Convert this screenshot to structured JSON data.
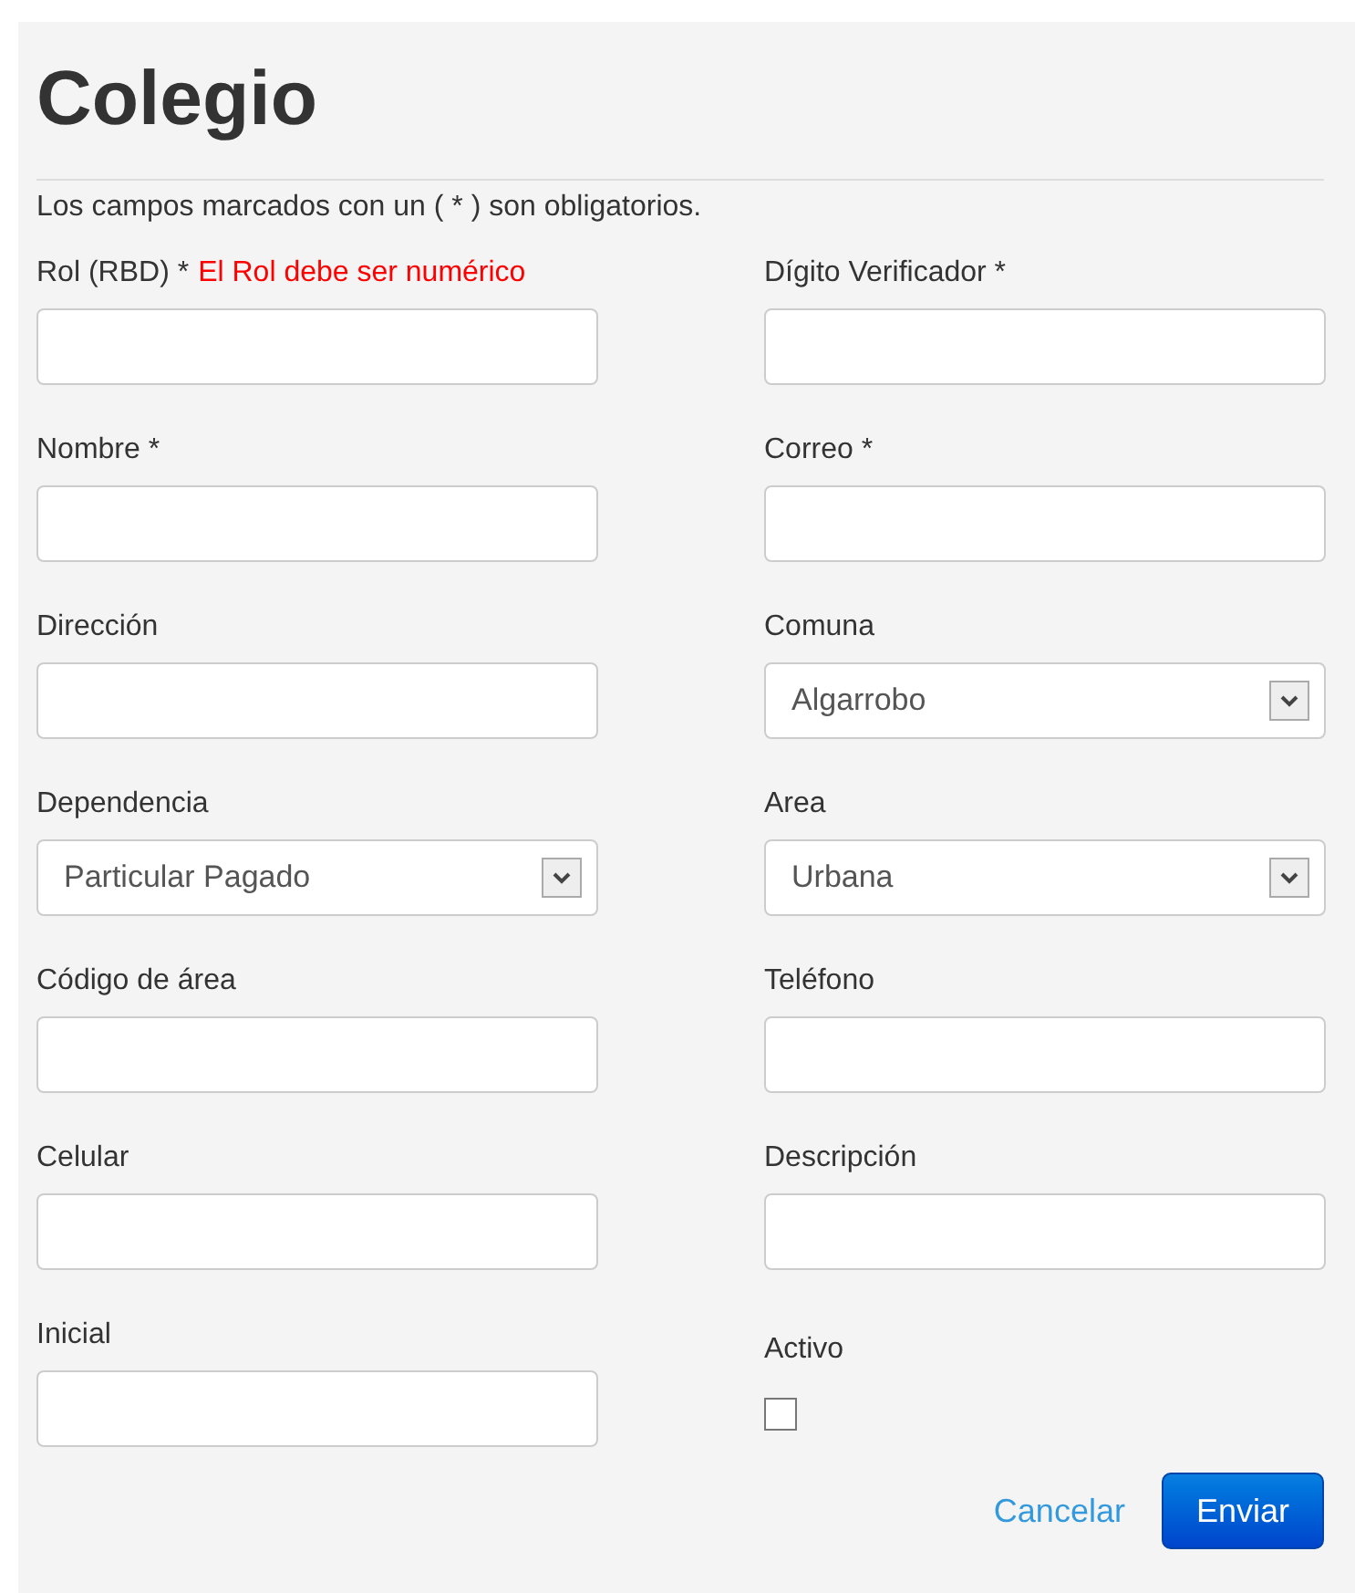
{
  "title": "Colegio",
  "note": "Los campos marcados con un ( * ) son obligatorios.",
  "fields": [
    {
      "kind": "text",
      "label": "Rol (RBD) *",
      "error": "El Rol debe ser numérico"
    },
    {
      "kind": "text",
      "label": "Dígito Verificador *"
    },
    {
      "kind": "text",
      "label": "Nombre *"
    },
    {
      "kind": "text",
      "label": "Correo *"
    },
    {
      "kind": "text",
      "label": "Dirección"
    },
    {
      "kind": "select",
      "label": "Comuna",
      "value": "Algarrobo"
    },
    {
      "kind": "select",
      "label": "Dependencia",
      "value": "Particular Pagado"
    },
    {
      "kind": "select",
      "label": "Area",
      "value": "Urbana"
    },
    {
      "kind": "text",
      "label": "Código de área"
    },
    {
      "kind": "text",
      "label": "Teléfono"
    },
    {
      "kind": "text",
      "label": "Celular"
    },
    {
      "kind": "text",
      "label": "Descripción"
    },
    {
      "kind": "text",
      "label": "Inicial"
    },
    {
      "kind": "checkbox",
      "label": "Activo",
      "checked": false
    }
  ],
  "actions": {
    "cancel": "Cancelar",
    "submit": "Enviar"
  }
}
